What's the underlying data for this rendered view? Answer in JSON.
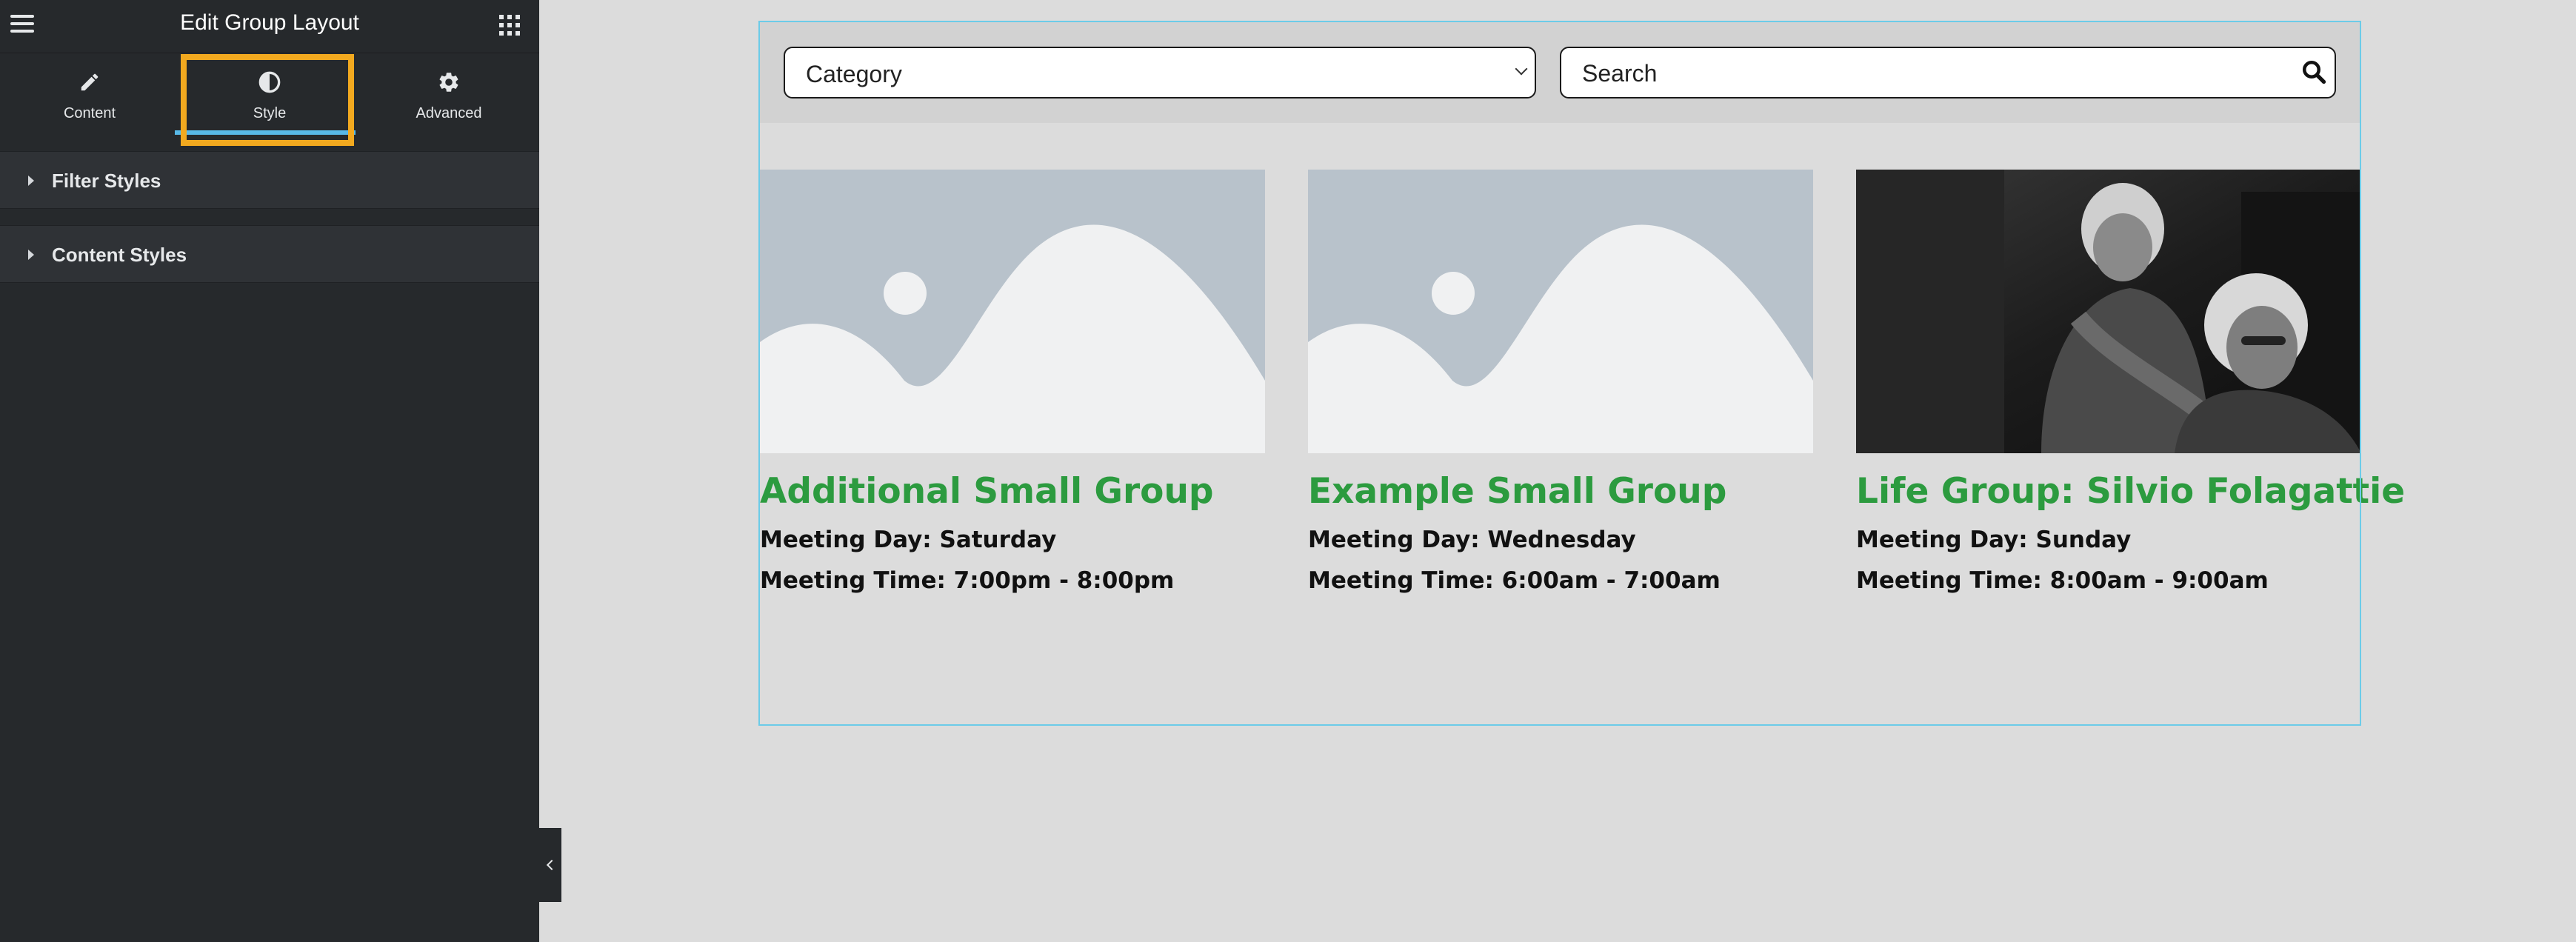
{
  "panel": {
    "title": "Edit Group Layout",
    "tabs": [
      {
        "label": "Content",
        "icon": "pencil-icon"
      },
      {
        "label": "Style",
        "icon": "half-circle-icon",
        "active": true
      },
      {
        "label": "Advanced",
        "icon": "gear-icon"
      }
    ],
    "sections": [
      {
        "label": "Filter Styles"
      },
      {
        "label": "Content Styles"
      }
    ]
  },
  "filters": {
    "category": "Category",
    "search_placeholder": "Search"
  },
  "groups": [
    {
      "title": "Additional Small Group",
      "day": "Meeting Day: Saturday",
      "time": "Meeting Time: 7:00pm - 8:00pm",
      "image": "placeholder"
    },
    {
      "title": "Example Small Group",
      "day": "Meeting Day: Wednesday",
      "time": "Meeting Time: 6:00am - 7:00am",
      "image": "placeholder"
    },
    {
      "title": "Life Group: Silvio Folagattie",
      "day": "Meeting Day: Sunday",
      "time": "Meeting Time: 8:00am - 9:00am",
      "image": "photo"
    }
  ],
  "colors": {
    "accent_green": "#2c9b3f",
    "highlight_orange": "#f2a91f",
    "active_tab_blue": "#58b9e8",
    "panel_bg": "#26292c"
  }
}
